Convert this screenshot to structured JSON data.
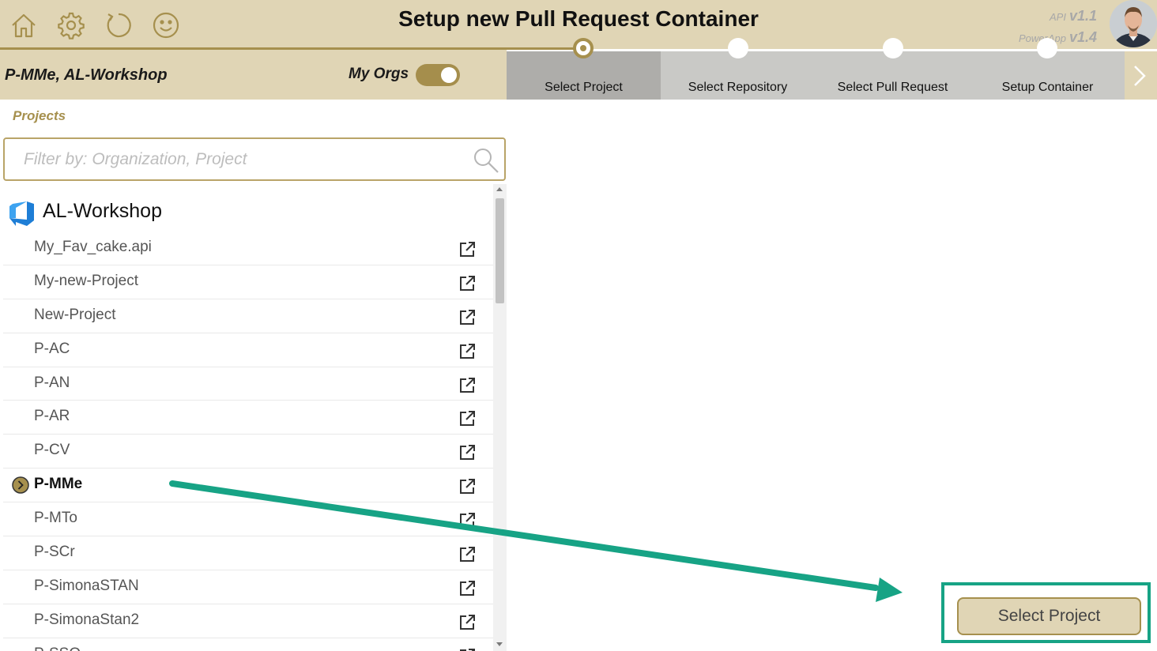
{
  "header": {
    "title": "Setup new Pull Request Container",
    "icons": [
      "home-icon",
      "gear-icon",
      "refresh-icon",
      "smiley-icon"
    ],
    "api_key": "API",
    "api_version": "v1.1",
    "app_key": "PowerApp",
    "app_version": "v1.4"
  },
  "subheader": {
    "breadcrumb": "P-MMe, AL-Workshop",
    "my_orgs_label": "My Orgs",
    "my_orgs_on": true
  },
  "steps": [
    {
      "label": "Select Project",
      "active": true
    },
    {
      "label": "Select Repository",
      "active": false
    },
    {
      "label": "Select Pull Request",
      "active": false
    },
    {
      "label": "Setup Container",
      "active": false
    }
  ],
  "projects": {
    "section_label": "Projects",
    "filter_placeholder": "Filter by: Organization, Project",
    "organization": "AL-Workshop",
    "items": [
      {
        "name": "My_Fav_cake.api",
        "selected": false
      },
      {
        "name": "My-new-Project",
        "selected": false
      },
      {
        "name": "New-Project",
        "selected": false
      },
      {
        "name": "P-AC",
        "selected": false
      },
      {
        "name": "P-AN",
        "selected": false
      },
      {
        "name": "P-AR",
        "selected": false
      },
      {
        "name": "P-CV",
        "selected": false
      },
      {
        "name": "P-MMe",
        "selected": true
      },
      {
        "name": "P-MTo",
        "selected": false
      },
      {
        "name": "P-SCr",
        "selected": false
      },
      {
        "name": "P-SimonaSTAN",
        "selected": false
      },
      {
        "name": "P-SimonaStan2",
        "selected": false
      },
      {
        "name": "P-SSO",
        "selected": false
      }
    ]
  },
  "action": {
    "select_project_label": "Select Project"
  },
  "colors": {
    "header_bg": "#e0d5b5",
    "accent_gold": "#a6904e",
    "annotation_green": "#17a385"
  }
}
